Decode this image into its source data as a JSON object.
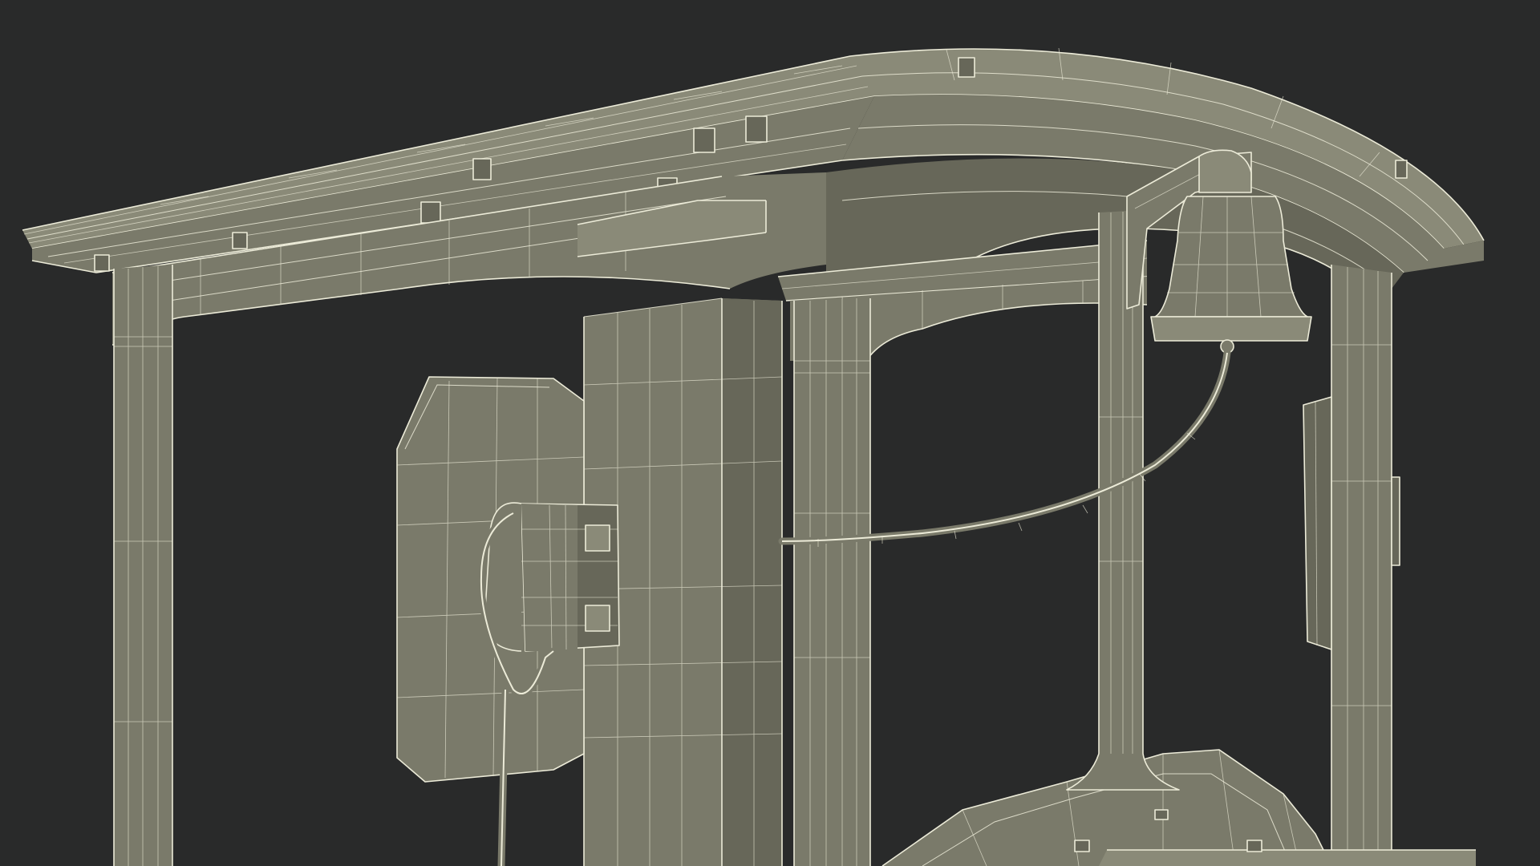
{
  "scene": {
    "background": "#292a2a",
    "surface_color": "#7a7a6a",
    "wireframe_color": "#ecebd8"
  }
}
